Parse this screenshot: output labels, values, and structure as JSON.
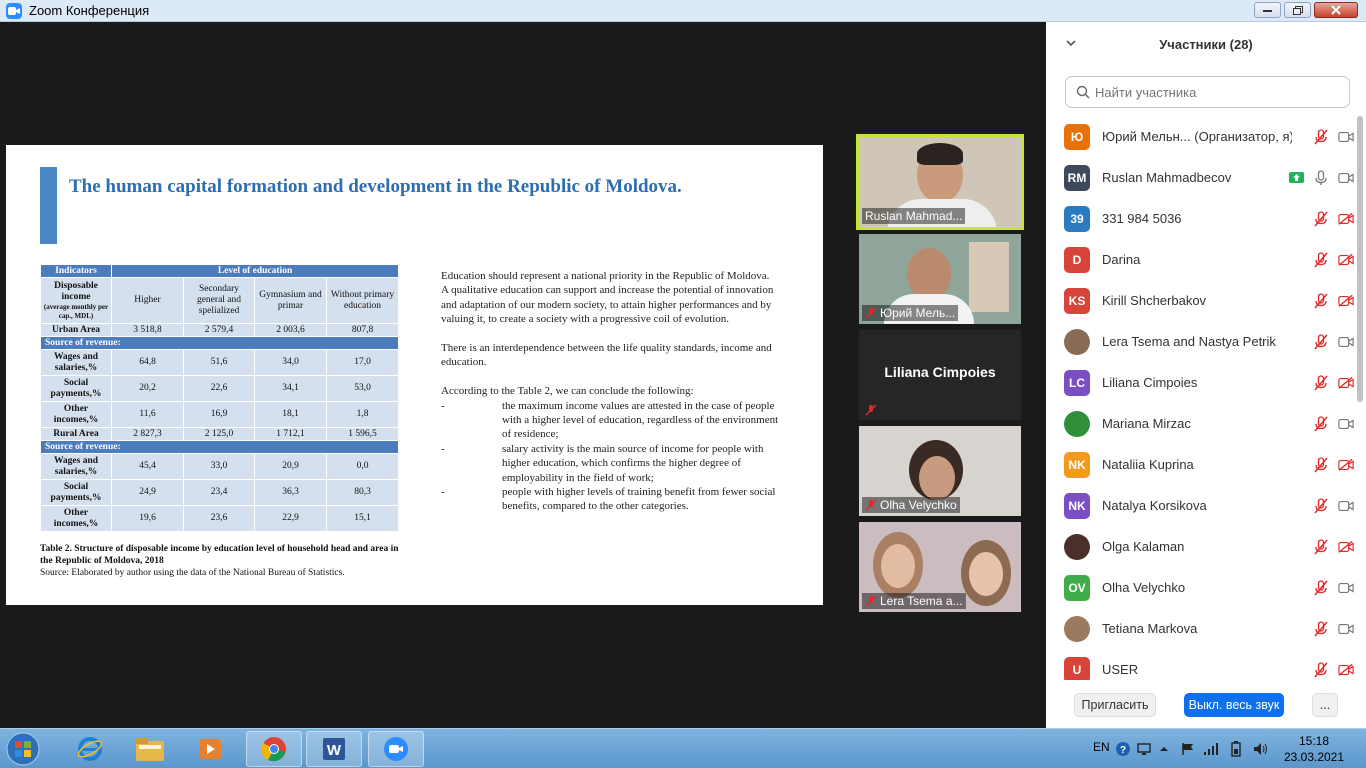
{
  "window": {
    "title": "Zoom Конференция"
  },
  "slide": {
    "title": "The human capital formation and development in the Republic of Moldova.",
    "table": {
      "h_indicators": "Indicators",
      "h_level": "Level of education",
      "h_income": "Disposable income",
      "h_income_note": "(average monthly per cap., MDL)",
      "cols": [
        "Higher",
        "Secondary general and spelialized",
        "Gymnasium and primar",
        "Without primary education"
      ],
      "urban": {
        "label": "Urban Area",
        "values": [
          "3 518,8",
          "2 579,4",
          "2 003,6",
          "807,8"
        ]
      },
      "rural": {
        "label": "Rural Area",
        "values": [
          "2 827,3",
          "2 125,0",
          "1 712,1",
          "1 596,5"
        ]
      },
      "source_label": "Source of revenue:",
      "urban_rows": [
        {
          "label": "Wages and salaries,%",
          "values": [
            "64,8",
            "51,6",
            "34,0",
            "17,0"
          ]
        },
        {
          "label": "Social payments,%",
          "values": [
            "20,2",
            "22,6",
            "34,1",
            "53,0"
          ]
        },
        {
          "label": "Other incomes,%",
          "values": [
            "11,6",
            "16,9",
            "18,1",
            "1,8"
          ]
        }
      ],
      "rural_rows": [
        {
          "label": "Wages and salaries,%",
          "values": [
            "45,4",
            "33,0",
            "20,9",
            "0,0"
          ]
        },
        {
          "label": "Social payments,%",
          "values": [
            "24,9",
            "23,4",
            "36,3",
            "80,3"
          ]
        },
        {
          "label": "Other incomes,%",
          "values": [
            "19,6",
            "23,6",
            "22,9",
            "15,1"
          ]
        }
      ]
    },
    "caption_bold": "Table 2.  Structure of disposable income by education level of household head and area in the Republic of Moldova, 2018",
    "caption_source": "Source: Elaborated by author using the data of the National Bureau of Statistics.",
    "p1": "Education should represent a national priority in the Republic of Moldova.",
    "p1b": "A qualitative education can support and increase the potential of innovation and adaptation of our modern society, to attain higher performances and by valuing it, to create a society with a progressive coil of evolution.",
    "p2": "There is an interdependence between the life quality standards, income and education.",
    "p3": "According to the Table 2, we can conclude the following:",
    "bullets": [
      "the maximum income values are attested in the case of people with a higher level of education, regardless of the environment of residence;",
      "salary activity is the main source of income for people with higher education, which confirms the higher degree of employability in the field of work;",
      "people with higher levels of training benefit from fewer social benefits, compared to the other categories."
    ],
    "bullet_dash": "-"
  },
  "thumbnails": [
    {
      "name": "Ruslan Mahmad..."
    },
    {
      "name": "Юрий Мель..."
    },
    {
      "name": "Liliana Cimpoies"
    },
    {
      "name": "Olha Velychko"
    },
    {
      "name": "Lera Tsema a..."
    }
  ],
  "panel": {
    "title": "Участники (28)",
    "search_placeholder": "Найти участника",
    "invite": "Пригласить",
    "mute_all": "Выкл. весь звук",
    "more": "...",
    "participants": [
      {
        "initials": "Ю",
        "color": "#e8710a",
        "name": "Юрий Мельн...  (Организатор, я)",
        "mic": "muted",
        "video": "on"
      },
      {
        "initials": "RM",
        "color": "#3c4a5a",
        "name": "Ruslan Mahmadbecov",
        "mic": "on",
        "video": "on",
        "share": true
      },
      {
        "initials": "39",
        "color": "#2b7bc0",
        "name": "331 984 5036",
        "mic": "muted",
        "video": "off"
      },
      {
        "initials": "D",
        "color": "#d9443a",
        "name": "Darina",
        "mic": "muted",
        "video": "off"
      },
      {
        "initials": "KS",
        "color": "#d9443a",
        "name": "Kirill Shcherbakov",
        "mic": "muted",
        "video": "off"
      },
      {
        "initials": "",
        "color": "#8a6b55",
        "name": "Lera Tsema and Nastya Petrik",
        "mic": "muted",
        "video": "on",
        "photo": true
      },
      {
        "initials": "LC",
        "color": "#7a4fc4",
        "name": "Liliana Cimpoies",
        "mic": "muted",
        "video": "off"
      },
      {
        "initials": "",
        "color": "#2f8f3a",
        "name": "Mariana Mirzac",
        "mic": "muted",
        "video": "on",
        "photo": true
      },
      {
        "initials": "NK",
        "color": "#f29a1e",
        "name": "Nataliia Kuprina",
        "mic": "muted",
        "video": "off"
      },
      {
        "initials": "NK",
        "color": "#7a4fc4",
        "name": "Natalya Korsikova",
        "mic": "muted",
        "video": "on"
      },
      {
        "initials": "",
        "color": "#4a2f2a",
        "name": "Olga Kalaman",
        "mic": "muted",
        "video": "off",
        "photo": true
      },
      {
        "initials": "OV",
        "color": "#3fae4a",
        "name": "Olha Velychko",
        "mic": "muted",
        "video": "on"
      },
      {
        "initials": "",
        "color": "#9b7a60",
        "name": "Tetiana Markova",
        "mic": "muted",
        "video": "on",
        "photo": true
      },
      {
        "initials": "U",
        "color": "#d9443a",
        "name": "USER",
        "mic": "muted",
        "video": "off"
      }
    ]
  },
  "taskbar": {
    "lang": "EN",
    "time": "15:18",
    "date": "23.03.2021"
  },
  "colors": {
    "accent": "#0e71eb",
    "muted": "#e02828",
    "slide_blue": "#4a7cbe",
    "active_speaker": "#c5e639"
  }
}
